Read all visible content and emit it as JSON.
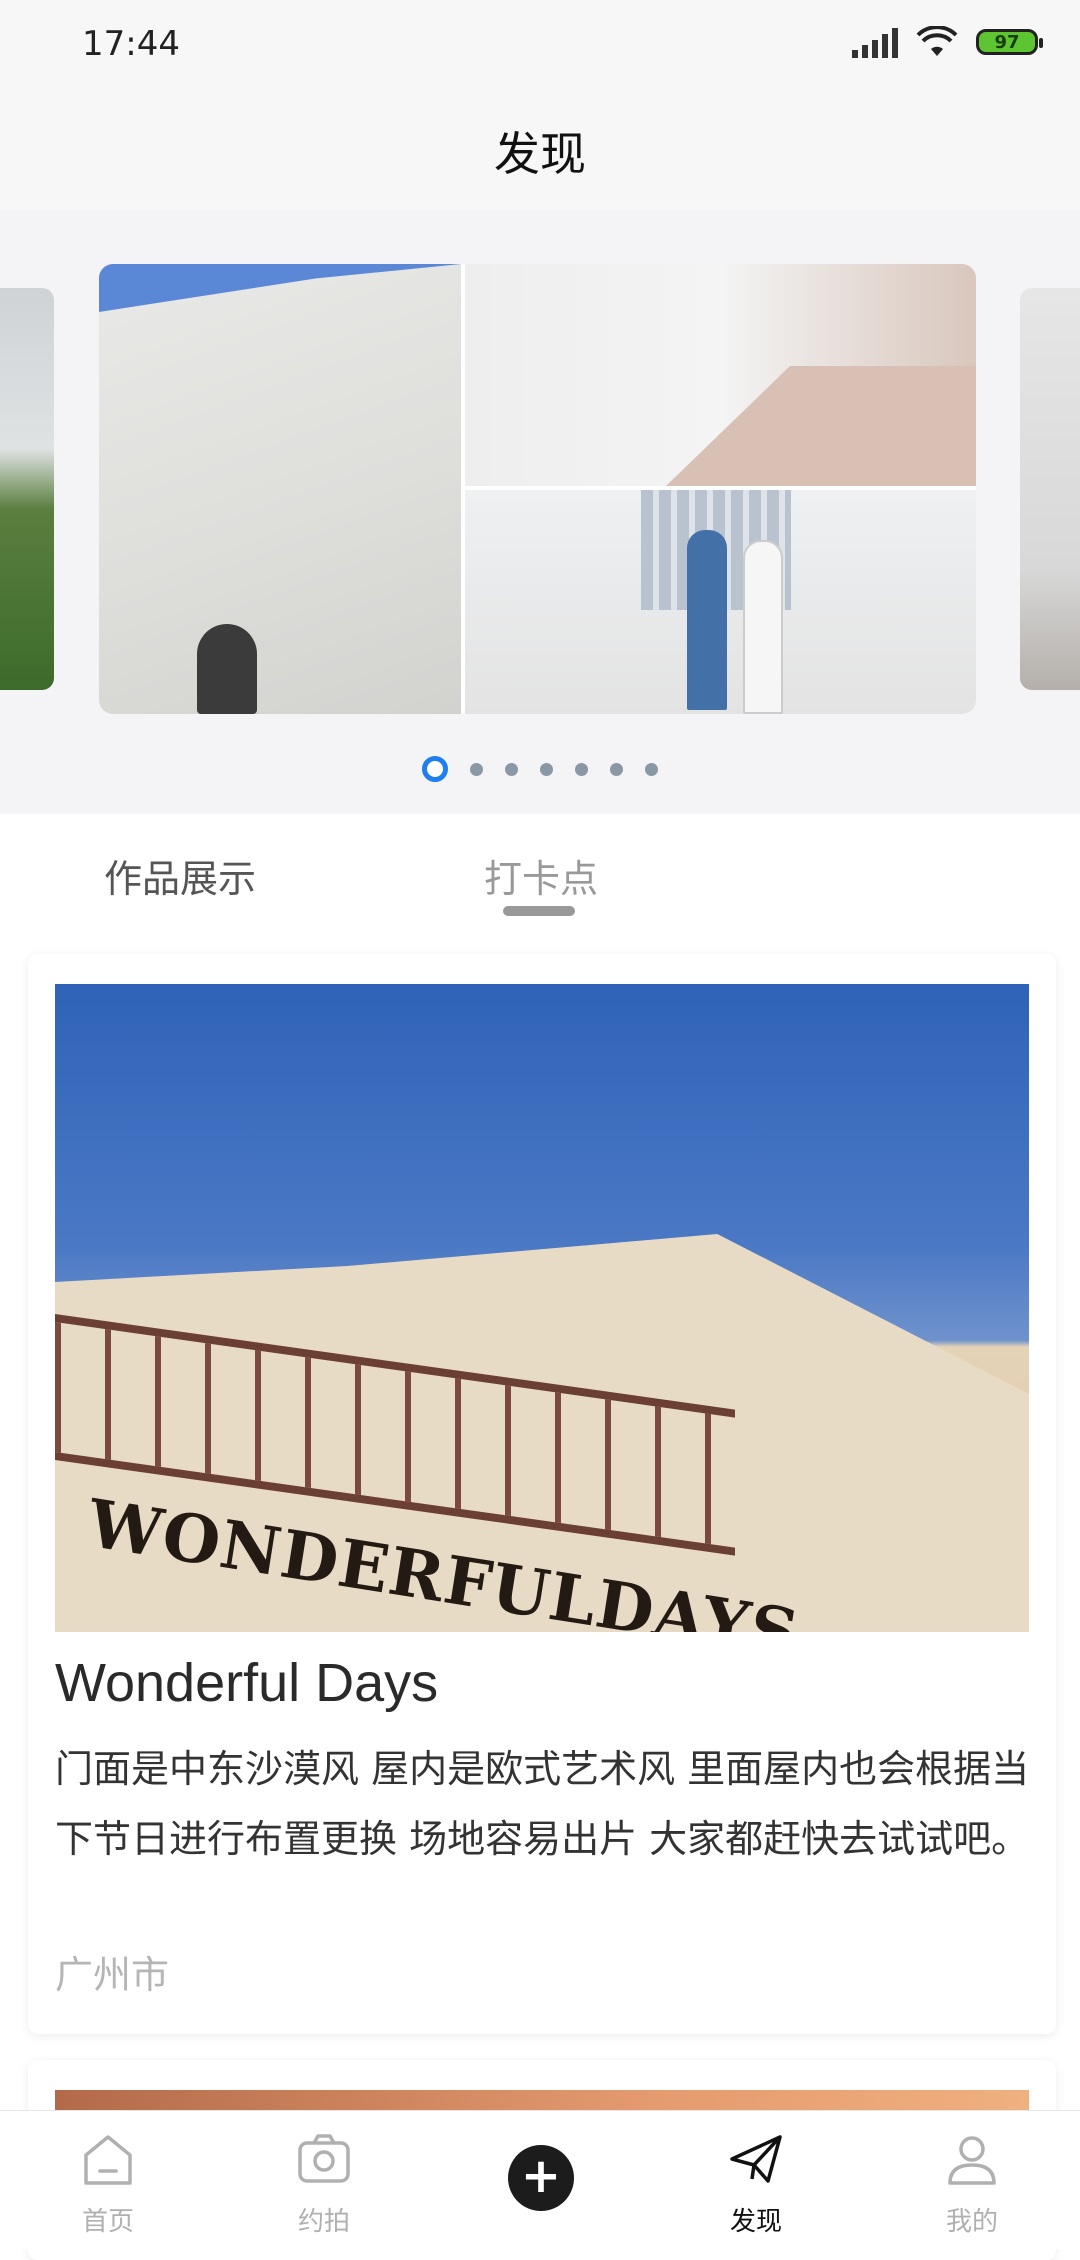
{
  "status_bar": {
    "time": "17:44",
    "battery": "97"
  },
  "header": {
    "title": "发现"
  },
  "banner": {
    "slide_count": 7,
    "active_index": 0
  },
  "tabs": [
    {
      "label": "作品展示",
      "active": false
    },
    {
      "label": "打卡点",
      "active": true
    }
  ],
  "card": {
    "title": "Wonderful Days",
    "photo_sign": "WONDERFULDAYS",
    "description": "门面是中东沙漠风 屋内是欧式艺术风 里面屋内也会根据当下节日进行布置更换 场地容易出片 大家都赶快去试试吧。",
    "city": "广州市"
  },
  "bottom_nav": [
    {
      "label": "首页",
      "icon": "home-icon",
      "active": false
    },
    {
      "label": "约拍",
      "icon": "camera-icon",
      "active": false
    },
    {
      "label": "",
      "icon": "plus-icon",
      "active": false
    },
    {
      "label": "发现",
      "icon": "paper-plane-icon",
      "active": true
    },
    {
      "label": "我的",
      "icon": "person-icon",
      "active": false
    }
  ],
  "colors": {
    "accent": "#1f7ef0",
    "nav_active": "#111111",
    "nav_inactive": "#b0b0b0",
    "battery": "#5cc531"
  }
}
